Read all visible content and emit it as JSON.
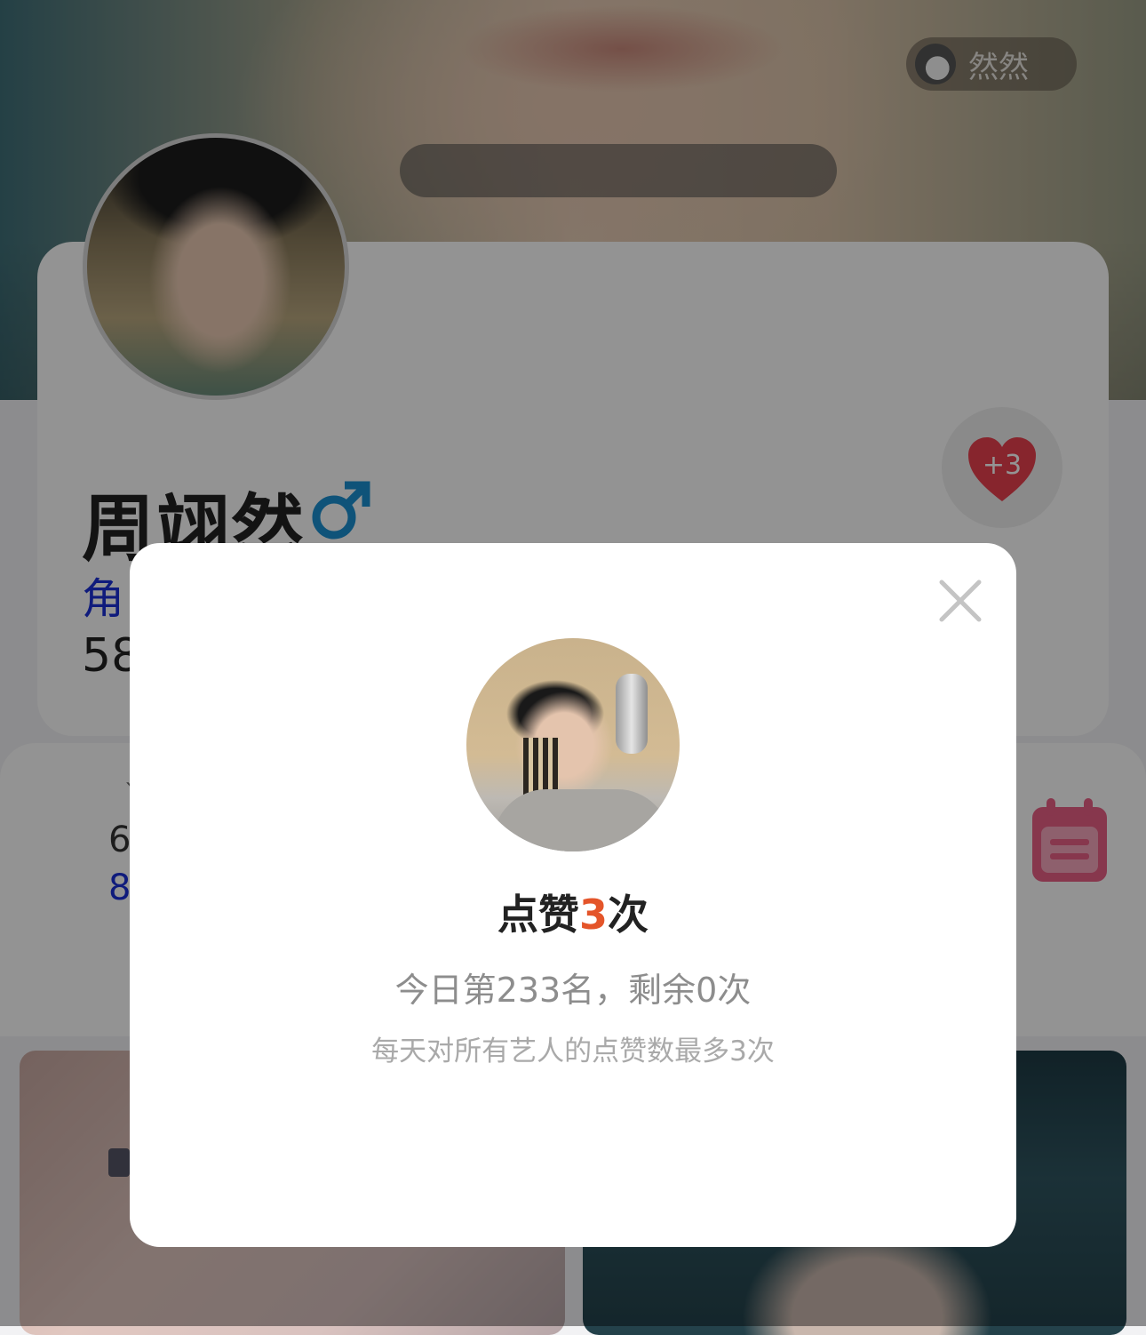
{
  "header": {
    "username": "然然"
  },
  "profile": {
    "name": "周翊然",
    "gender_symbol": "♂",
    "role_label": "角",
    "count_partial": "58",
    "like_badge": "+3"
  },
  "stats": {
    "tick": "ˋ",
    "line1_partial": "6",
    "line2_partial": "8"
  },
  "modal": {
    "title_prefix": "点赞",
    "title_count": "3",
    "title_suffix": "次",
    "rank_text": "今日第233名，剩余0次",
    "note_text": "每天对所有艺人的点赞数最多3次"
  },
  "colors": {
    "accent_orange": "#e4552a",
    "link_blue": "#1a2fd6",
    "heart_red": "#e9414f",
    "gender_blue": "#1a8fd0",
    "calendar_pink": "#e85f86"
  },
  "icons": {
    "close": "close-icon",
    "heart": "heart-icon",
    "calendar": "calendar-icon",
    "gender": "male-icon"
  }
}
